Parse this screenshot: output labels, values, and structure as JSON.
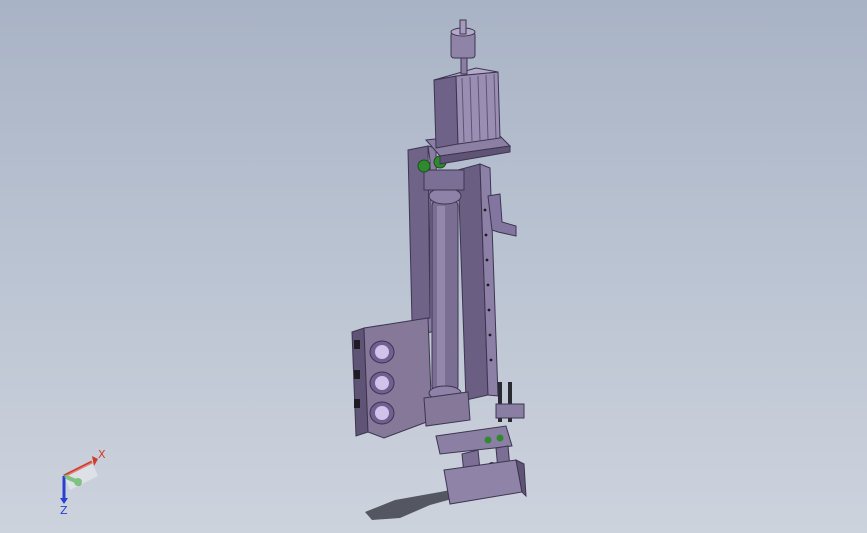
{
  "viewport": {
    "background_top": "#a8b3c5",
    "background_bottom": "#cdd3dd"
  },
  "model": {
    "part_color": "#7e7196",
    "part_shadow": "#5f5475",
    "fastener_green": "#3da13d",
    "fastener_lilac": "#c9b8e6"
  },
  "triad": {
    "x_label": "X",
    "z_label": "Z",
    "x_color": "#d13a2a",
    "y_color": "#3da13d",
    "z_color": "#2a3fd1"
  }
}
